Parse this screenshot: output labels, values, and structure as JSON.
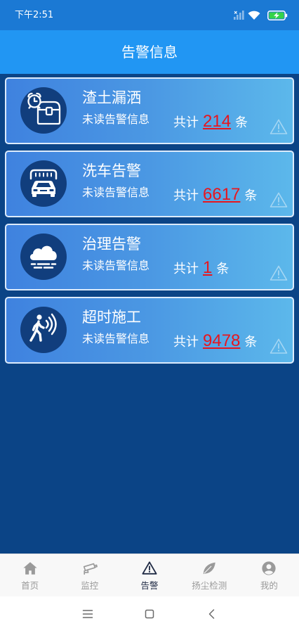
{
  "status_bar": {
    "time": "下午2:51",
    "icons": [
      "signal-icon",
      "wifi-icon",
      "battery-charging-icon"
    ]
  },
  "header": {
    "title": "告警信息"
  },
  "alerts": [
    {
      "title": "渣土漏洒",
      "subtitle": "未读告警信息",
      "total_label": "共计",
      "count": "214",
      "unit": "条",
      "icon": "alarm-chest-icon"
    },
    {
      "title": "洗车告警",
      "subtitle": "未读告警信息",
      "total_label": "共计",
      "count": "6617",
      "unit": "条",
      "icon": "car-wash-icon"
    },
    {
      "title": "治理告警",
      "subtitle": "未读告警信息",
      "total_label": "共计",
      "count": "1",
      "unit": "条",
      "icon": "smog-cloud-icon"
    },
    {
      "title": "超时施工",
      "subtitle": "未读告警信息",
      "total_label": "共计",
      "count": "9478",
      "unit": "条",
      "icon": "pedestrian-signal-icon"
    }
  ],
  "tabbar": {
    "items": [
      {
        "label": "首页",
        "icon": "home-icon",
        "active": false
      },
      {
        "label": "监控",
        "icon": "cctv-camera-icon",
        "active": false
      },
      {
        "label": "告警",
        "icon": "warning-icon",
        "active": true
      },
      {
        "label": "扬尘检测",
        "icon": "leaf-icon",
        "active": false
      },
      {
        "label": "我的",
        "icon": "user-icon",
        "active": false
      }
    ]
  },
  "system_nav": {
    "icons": [
      "menu-icon",
      "square-icon",
      "chevron-left-icon"
    ]
  },
  "colors": {
    "status_bar": "#1b79d4",
    "header": "#2196f3",
    "background": "#0b4486",
    "icon_badge": "#113e7d",
    "count": "#e8161e",
    "tab_active": "#1f2a44",
    "tab_inactive": "#9a9a9a"
  }
}
